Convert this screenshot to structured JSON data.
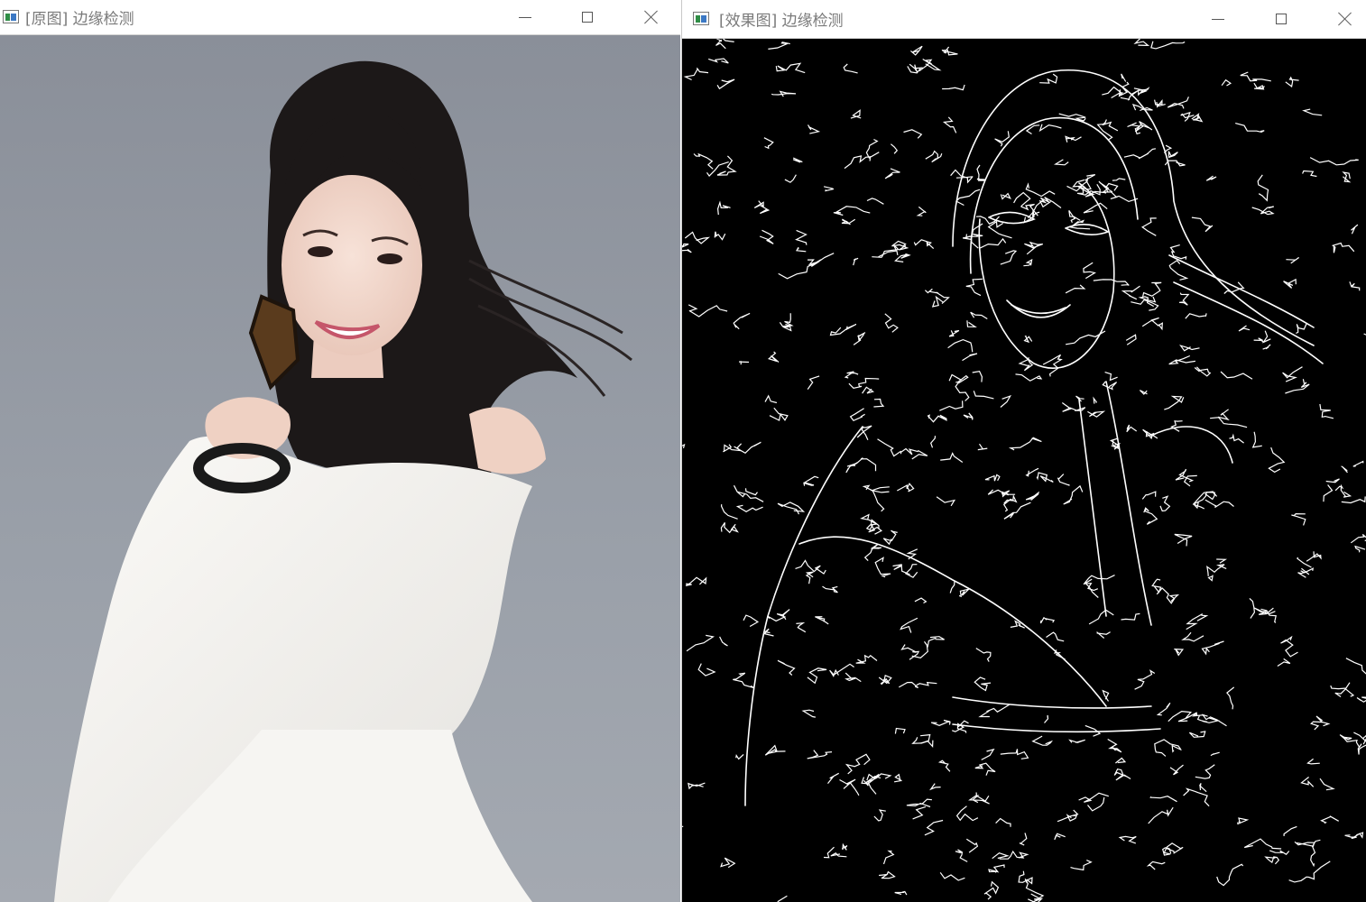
{
  "windows": {
    "original": {
      "title": "[原图] 边缘检测",
      "image": "photo-woman-white-outfit"
    },
    "result": {
      "title": "[效果图] 边缘检测",
      "image": "canny-edge-map"
    }
  },
  "controls": {
    "minimize_icon": "minimize-icon",
    "maximize_icon": "maximize-icon",
    "close_icon": "close-icon"
  },
  "colors": {
    "photo_background": "#8e939d",
    "hair": "#1b1717",
    "outfit": "#f4f2ee",
    "skin": "#f1d8cc",
    "edge_background": "#000000",
    "edge_line": "#ffffff"
  }
}
